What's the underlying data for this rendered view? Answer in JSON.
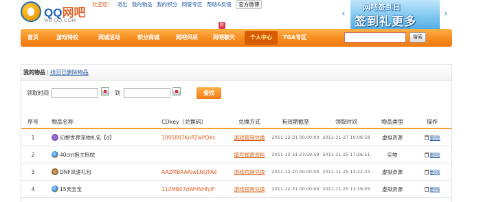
{
  "logo": {
    "qq": "QQ",
    "wb": "网吧",
    "url": "WB.QQ.COM"
  },
  "toplinks": {
    "welcome": "欢迎您！",
    "items": [
      "退出",
      "我的物品",
      "我的积分",
      "网管专区",
      "帮助&反馈"
    ],
    "wechat": "官方微博"
  },
  "banner": {
    "line1": "网吧签到日",
    "line2": "签到礼更多",
    "prev": "‹",
    "next": "›"
  },
  "nav": {
    "items": [
      "首页",
      "游戏特权",
      "网城活动",
      "积分商城",
      "网吧风采",
      "网吧聊天",
      "个人中心",
      "TGA专区"
    ],
    "active_index": 6,
    "new_badge": "新",
    "search_button": "搜索"
  },
  "panel": {
    "title": "我的物品",
    "separator": "|",
    "link": "找回已删除物品"
  },
  "filter": {
    "label": "领取时间",
    "to": "到",
    "button": "查找"
  },
  "table": {
    "headers": [
      "序号",
      "物品名称",
      "CDkey（兑换码）",
      "兑换方式",
      "有效期截至",
      "领取时间",
      "物品类型",
      "操作"
    ],
    "rows": [
      {
        "no": "1",
        "icon": "butterfly-icon",
        "name": "幻想世界宠物礼包【d】",
        "key": "1095807KnPZwPQXs",
        "method": "游戏官网兑换",
        "expire": "2011-12-31 00:00:00",
        "received": "2011-11-27 10:08:58",
        "type": "虚拟资源",
        "op": "删除"
      },
      {
        "no": "2",
        "icon": "ie-icon",
        "name": "40cm抱主抱枕",
        "key": "",
        "method": "填写邮寄资料",
        "expire": "2011-12-31 23:59:59",
        "received": "2011-11-25 17:26:51",
        "type": "实物",
        "op": "删除"
      },
      {
        "no": "3",
        "icon": "dnf-icon",
        "name": "DNF风速礼包",
        "key": "AAZMBAAAjwLNQPAé",
        "method": "游戏官网兑换",
        "expire": "2011-12-20 00:00:00",
        "received": "2011-11-25 13:22:33",
        "type": "虚拟资源",
        "op": "删除"
      },
      {
        "no": "4",
        "icon": "ie-icon",
        "name": "15天宝宝",
        "key": "112MB07dWHNHfylF",
        "method": "游戏官网兑换",
        "expire": "2011-12-31 00:00:00",
        "received": "2011-11-25 13:19:05",
        "type": "虚拟资源",
        "op": "删除"
      }
    ]
  }
}
